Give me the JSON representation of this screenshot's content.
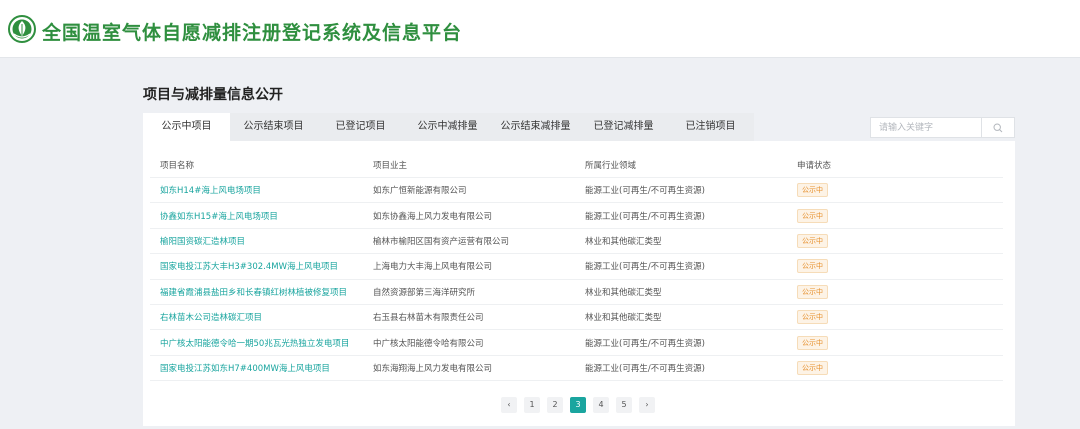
{
  "header": {
    "title": "全国温室气体自愿减排注册登记系统及信息平台"
  },
  "section": {
    "title": "项目与减排量信息公开"
  },
  "tabs": [
    {
      "label": "公示中项目"
    },
    {
      "label": "公示结束项目"
    },
    {
      "label": "已登记项目"
    },
    {
      "label": "公示中减排量"
    },
    {
      "label": "公示结束减排量"
    },
    {
      "label": "已登记减排量"
    },
    {
      "label": "已注销项目"
    }
  ],
  "search": {
    "placeholder": "请输入关键字",
    "value": ""
  },
  "table": {
    "columns": [
      "项目名称",
      "项目业主",
      "所属行业领域",
      "申请状态"
    ],
    "rows": [
      {
        "name": "如东H14#海上风电场项目",
        "owner": "如东广恒新能源有限公司",
        "field": "能源工业(可再生/不可再生资源)",
        "status": "公示中"
      },
      {
        "name": "协鑫如东H15#海上风电场项目",
        "owner": "如东协鑫海上风力发电有限公司",
        "field": "能源工业(可再生/不可再生资源)",
        "status": "公示中"
      },
      {
        "name": "榆阳国资碳汇造林项目",
        "owner": "榆林市榆阳区国有资产运营有限公司",
        "field": "林业和其他碳汇类型",
        "status": "公示中"
      },
      {
        "name": "国家电投江苏大丰H3#302.4MW海上风电项目",
        "owner": "上海电力大丰海上风电有限公司",
        "field": "能源工业(可再生/不可再生资源)",
        "status": "公示中"
      },
      {
        "name": "福建省霞浦县盐田乡和长春镇红树林植被修复项目",
        "owner": "自然资源部第三海洋研究所",
        "field": "林业和其他碳汇类型",
        "status": "公示中"
      },
      {
        "name": "右林苗木公司造林碳汇项目",
        "owner": "右玉县右林苗木有限责任公司",
        "field": "林业和其他碳汇类型",
        "status": "公示中"
      },
      {
        "name": "中广核太阳能德令哈一期50兆瓦光热独立发电项目",
        "owner": "中广核太阳能德令哈有限公司",
        "field": "能源工业(可再生/不可再生资源)",
        "status": "公示中"
      },
      {
        "name": "国家电投江苏如东H7#400MW海上风电项目",
        "owner": "如东海翔海上风力发电有限公司",
        "field": "能源工业(可再生/不可再生资源)",
        "status": "公示中"
      }
    ]
  },
  "pagination": {
    "prev": "‹",
    "next": "›",
    "pages": [
      "1",
      "2",
      "3",
      "4",
      "5"
    ],
    "current": "3"
  },
  "colors": {
    "brand_green": "#2f8f3f",
    "accent": "#1aa59f",
    "status": "#e6902d"
  }
}
